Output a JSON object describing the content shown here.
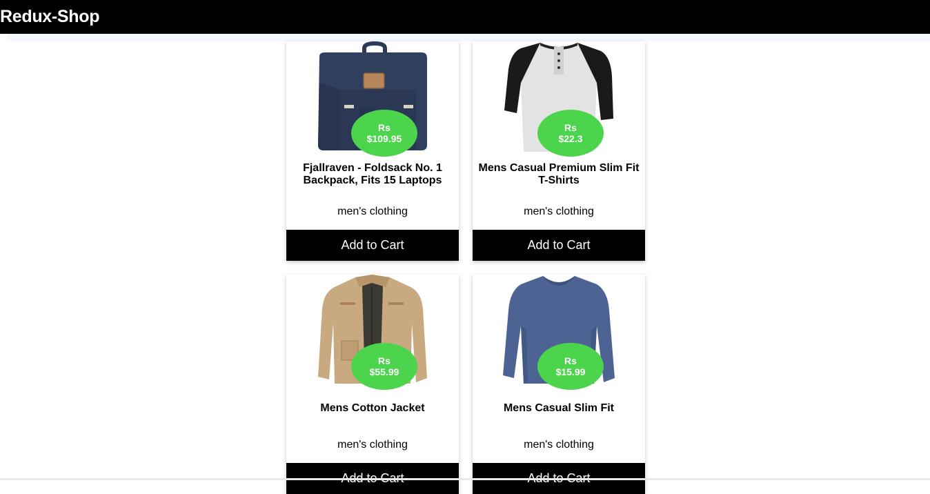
{
  "app": {
    "brand": "Redux-Shop"
  },
  "products": [
    {
      "title": "Fjallraven - Foldsack No. 1 Backpack, Fits 15 Laptops",
      "currency": "Rs",
      "price": "$109.95",
      "category": "men's clothing",
      "button": "Add to Cart",
      "icon": "backpack-image"
    },
    {
      "title": "Mens Casual Premium Slim Fit T-Shirts",
      "currency": "Rs",
      "price": "$22.3",
      "category": "men's clothing",
      "button": "Add to Cart",
      "icon": "tshirt-image"
    },
    {
      "title": "Mens Cotton Jacket",
      "currency": "Rs",
      "price": "$55.99",
      "category": "men's clothing",
      "button": "Add to Cart",
      "icon": "jacket-image"
    },
    {
      "title": "Mens Casual Slim Fit",
      "currency": "Rs",
      "price": "$15.99",
      "category": "men's clothing",
      "button": "Add to Cart",
      "icon": "longsleeve-image"
    }
  ],
  "colors": {
    "price_badge": "#4cd44c",
    "navbar": "#000000",
    "button": "#000000"
  }
}
